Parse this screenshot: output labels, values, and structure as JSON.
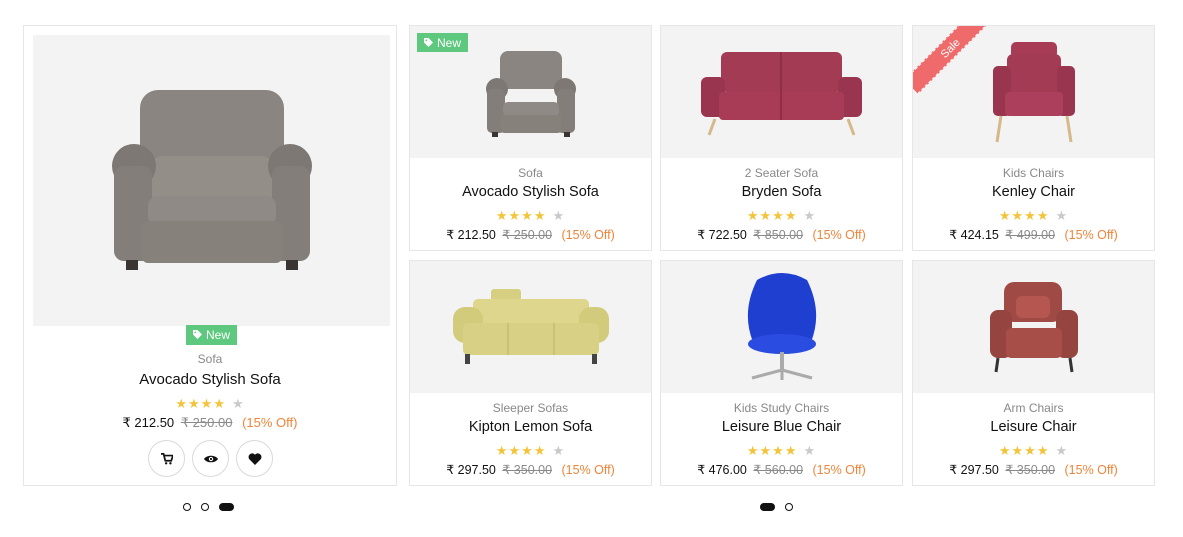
{
  "featured": {
    "badge": "New",
    "category": "Sofa",
    "title": "Avocado Stylish Sofa",
    "rating": 4,
    "price": "₹ 212.50",
    "old_price": "₹ 250.00",
    "discount": "(15% Off)",
    "actions": [
      "cart-icon",
      "eye-icon",
      "heart-icon"
    ]
  },
  "products": [
    {
      "category": "Sofa",
      "title": "Avocado Stylish Sofa",
      "rating": 4,
      "price": "₹ 212.50",
      "old_price": "₹ 250.00",
      "discount": "(15% Off)",
      "badge": "New"
    },
    {
      "category": "2 Seater Sofa",
      "title": "Bryden Sofa",
      "rating": 4,
      "price": "₹ 722.50",
      "old_price": "₹ 850.00",
      "discount": "(15% Off)",
      "badge": ""
    },
    {
      "category": "Kids Chairs",
      "title": "Kenley Chair",
      "rating": 4,
      "price": "₹ 424.15",
      "old_price": "₹ 499.00",
      "discount": "(15% Off)",
      "badge": "Sale"
    },
    {
      "category": "Sleeper Sofas",
      "title": "Kipton Lemon Sofa",
      "rating": 4,
      "price": "₹ 297.50",
      "old_price": "₹ 350.00",
      "discount": "(15% Off)",
      "badge": ""
    },
    {
      "category": "Kids Study Chairs",
      "title": "Leisure Blue Chair",
      "rating": 4,
      "price": "₹ 476.00",
      "old_price": "₹ 560.00",
      "discount": "(15% Off)",
      "badge": ""
    },
    {
      "category": "Arm Chairs",
      "title": "Leisure Chair",
      "rating": 4,
      "price": "₹ 297.50",
      "old_price": "₹ 350.00",
      "discount": "(15% Off)",
      "badge": ""
    }
  ],
  "pagination_left": {
    "count": 3,
    "active": 2
  },
  "pagination_right": {
    "count": 2,
    "active": 0
  },
  "colors": {
    "new_badge": "#5dc87e",
    "sale_ribbon": "#ef6b6b",
    "star_on": "#f3c43a",
    "star_off": "#c9c9c9",
    "discount": "#f0843a"
  }
}
